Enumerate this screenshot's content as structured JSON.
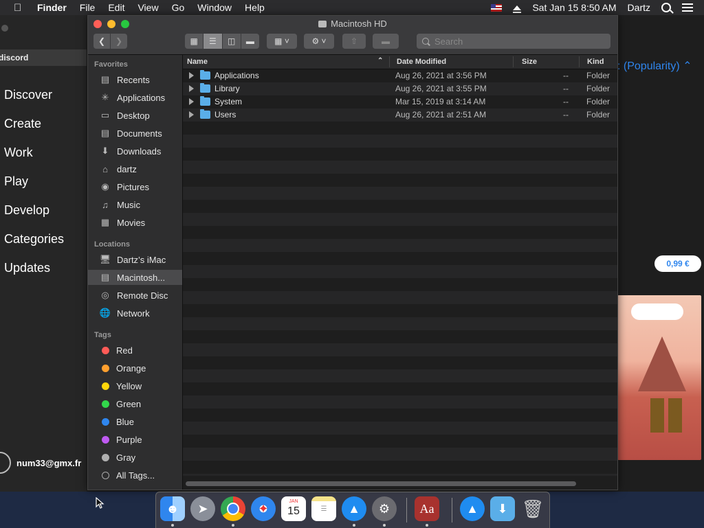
{
  "menubar": {
    "app_name": "Finder",
    "items": [
      "File",
      "Edit",
      "View",
      "Go",
      "Window",
      "Help"
    ],
    "datetime": "Sat Jan 15  8:50 AM",
    "user": "Dartz"
  },
  "appstore": {
    "search_text": "discord",
    "nav": [
      "Discover",
      "Create",
      "Work",
      "Play",
      "Develop",
      "Categories",
      "Updates"
    ],
    "account_email": "num33@gmx.fr",
    "sort_label": ": (Popularity)",
    "price": "0,99 €"
  },
  "finder": {
    "title": "Macintosh HD",
    "search_placeholder": "Search",
    "sidebar": {
      "favorites_heading": "Favorites",
      "favorites": [
        {
          "label": "Recents",
          "icon": "recents-icon"
        },
        {
          "label": "Applications",
          "icon": "applications-icon"
        },
        {
          "label": "Desktop",
          "icon": "desktop-icon"
        },
        {
          "label": "Documents",
          "icon": "documents-icon"
        },
        {
          "label": "Downloads",
          "icon": "downloads-icon"
        },
        {
          "label": "dartz",
          "icon": "home-icon"
        },
        {
          "label": "Pictures",
          "icon": "pictures-icon"
        },
        {
          "label": "Music",
          "icon": "music-icon"
        },
        {
          "label": "Movies",
          "icon": "movies-icon"
        }
      ],
      "locations_heading": "Locations",
      "locations": [
        {
          "label": "Dartz’s iMac",
          "icon": "imac-icon"
        },
        {
          "label": "Macintosh...",
          "icon": "hard-drive-icon",
          "selected": true
        },
        {
          "label": "Remote Disc",
          "icon": "disc-icon"
        },
        {
          "label": "Network",
          "icon": "network-icon"
        }
      ],
      "tags_heading": "Tags",
      "tags": [
        {
          "label": "Red",
          "color": "#ff5b57"
        },
        {
          "label": "Orange",
          "color": "#ff9f2e"
        },
        {
          "label": "Yellow",
          "color": "#ffd60a"
        },
        {
          "label": "Green",
          "color": "#32d74b"
        },
        {
          "label": "Blue",
          "color": "#2f86ee"
        },
        {
          "label": "Purple",
          "color": "#bf5af2"
        },
        {
          "label": "Gray",
          "color": "#b0b0b0"
        },
        {
          "label": "All Tags...",
          "color": "none"
        }
      ]
    },
    "columns": [
      "Name",
      "Date Modified",
      "Size",
      "Kind"
    ],
    "rows": [
      {
        "name": "Applications",
        "date": "Aug 26, 2021 at 3:56 PM",
        "size": "--",
        "kind": "Folder"
      },
      {
        "name": "Library",
        "date": "Aug 26, 2021 at 3:55 PM",
        "size": "--",
        "kind": "Folder"
      },
      {
        "name": "System",
        "date": "Mar 15, 2019 at 3:14 AM",
        "size": "--",
        "kind": "Folder"
      },
      {
        "name": "Users",
        "date": "Aug 26, 2021 at 2:51 AM",
        "size": "--",
        "kind": "Folder"
      }
    ]
  },
  "dock": {
    "calendar_month": "JAN",
    "calendar_day": "15",
    "dictionary_glyph": "Aa"
  }
}
